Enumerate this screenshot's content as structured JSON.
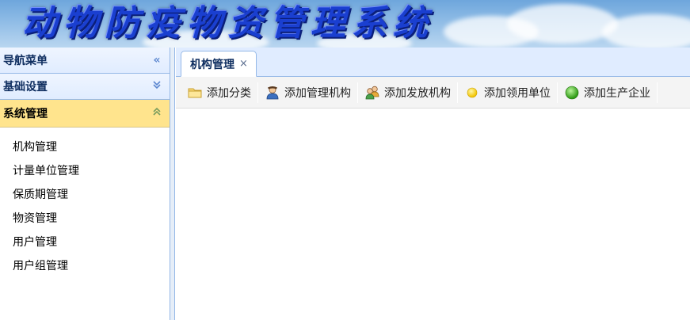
{
  "banner": {
    "title": "动物防疫物资管理系统"
  },
  "sidebar": {
    "header_navigation": "导航菜单",
    "header_navigation_icon": "double-chevron-left-icon",
    "sections": [
      {
        "label": "基础设置",
        "icon": "double-chevron-down-icon"
      },
      {
        "label": "系统管理",
        "icon": "double-chevron-up-icon"
      }
    ],
    "items": [
      {
        "label": "机构管理"
      },
      {
        "label": "计量单位管理"
      },
      {
        "label": "保质期管理"
      },
      {
        "label": "物资管理"
      },
      {
        "label": "用户管理"
      },
      {
        "label": "用户组管理"
      }
    ]
  },
  "tabs": [
    {
      "label": "机构管理",
      "close": "×"
    }
  ],
  "toolbar": {
    "buttons": [
      {
        "label": "添加分类",
        "icon": "folder-icon"
      },
      {
        "label": "添加管理机构",
        "icon": "user-icon"
      },
      {
        "label": "添加发放机构",
        "icon": "users-icon"
      },
      {
        "label": "添加领用单位",
        "icon": "yellow-dot-icon"
      },
      {
        "label": "添加生产企业",
        "icon": "green-dot-icon"
      }
    ]
  },
  "colors": {
    "panel_border": "#95b8e7",
    "header_bg": "#e0ecff",
    "active_section_bg": "#ffe48d",
    "banner_title": "#1a3fd0"
  }
}
